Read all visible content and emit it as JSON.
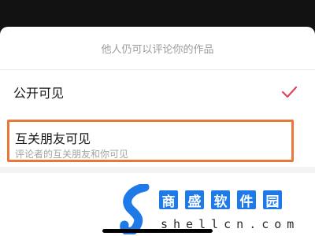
{
  "sheet": {
    "header": "他人仍可以评论你的作品",
    "options": [
      {
        "label": "公开可见",
        "selected": true
      },
      {
        "label": "互关朋友可见",
        "subtitle": "评论者的互关朋友和你可见",
        "highlighted": true
      }
    ]
  },
  "watermark": {
    "chars": [
      "商",
      "盛",
      "软",
      "件",
      "园"
    ],
    "domain": "shellcn.com"
  },
  "colors": {
    "accent_check": "#e0445e",
    "highlight_border": "#e8783a",
    "brand_blue": "#1e7ae8"
  },
  "icons": {
    "selected": "check-icon",
    "brand": "logo-icon"
  }
}
